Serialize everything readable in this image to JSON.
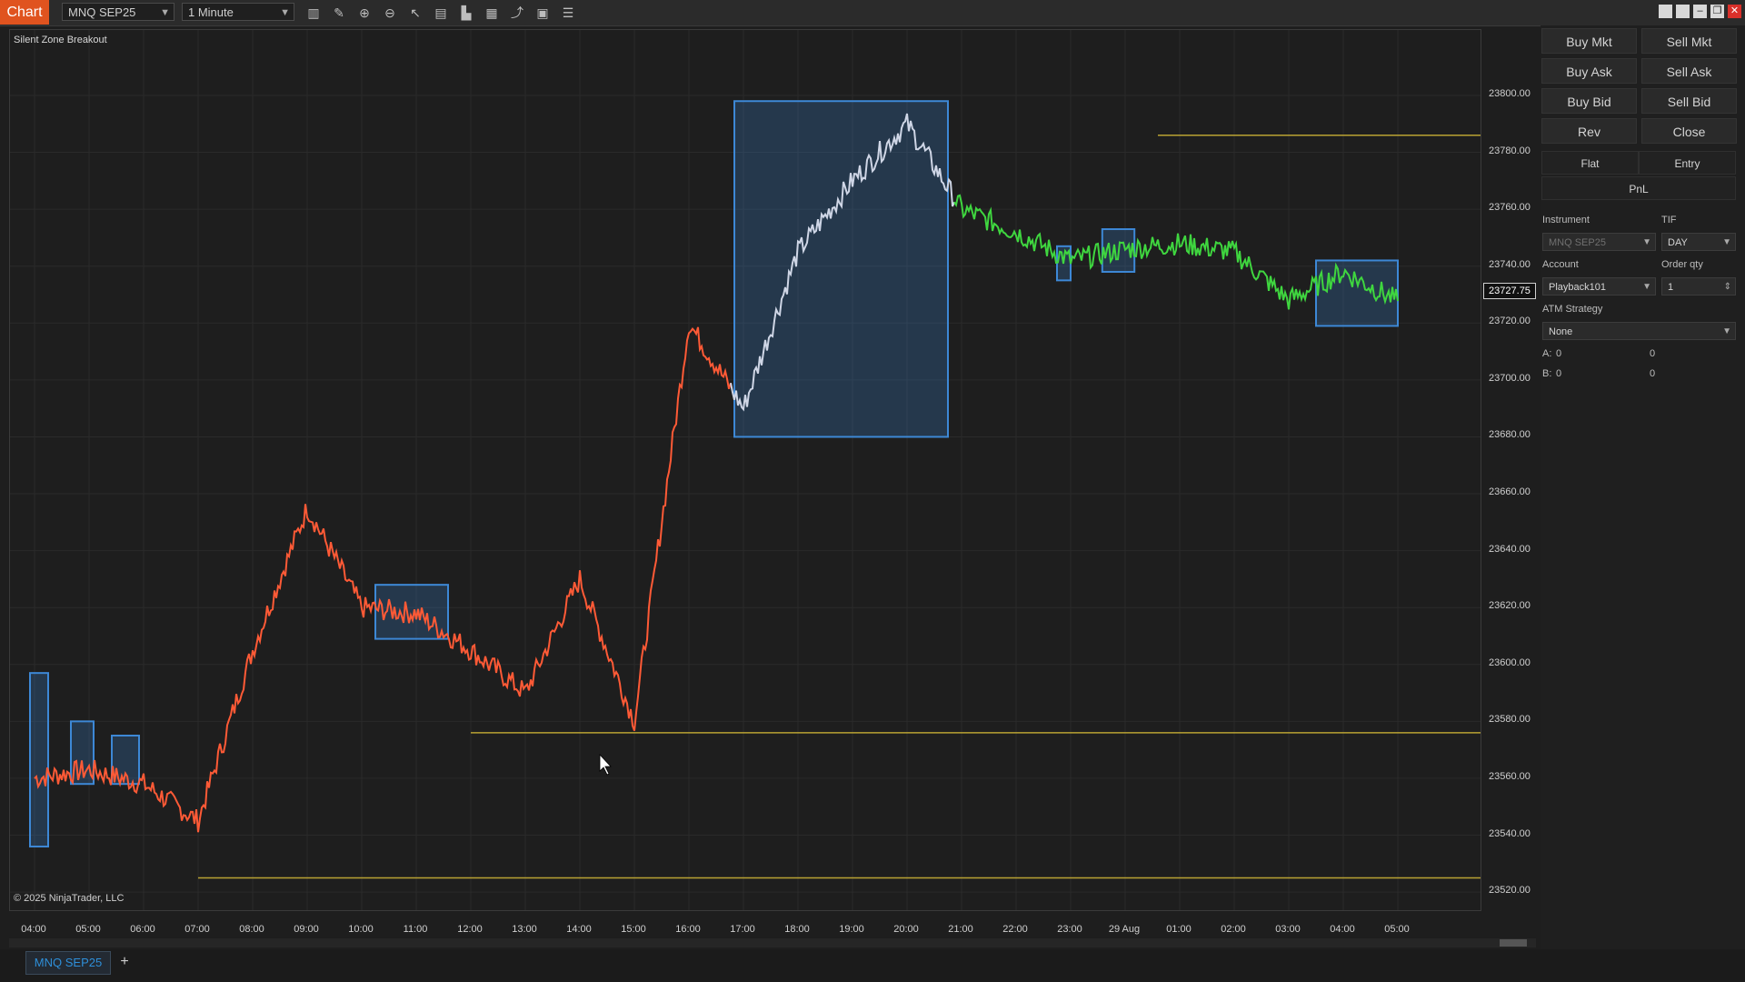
{
  "toolbar": {
    "chart_tab": "Chart",
    "instrument": "MNQ SEP25",
    "interval": "1 Minute",
    "icons": [
      "bar-type-icon",
      "draw-tool-icon",
      "zoom-in-icon",
      "zoom-out-icon",
      "pointer-icon",
      "data-box-icon",
      "properties-icon",
      "indicators-icon",
      "strategies-icon",
      "templates-icon",
      "list-icon"
    ],
    "window_buttons": [
      "tile-icon",
      "workspace-icon",
      "minimize-icon",
      "restore-icon",
      "close-icon"
    ]
  },
  "chart": {
    "title": "Silent Zone Breakout",
    "copyright": "© 2025 NinjaTrader, LLC",
    "current_price": "23727.75",
    "y_labels": [
      "23800.00",
      "23780.00",
      "23760.00",
      "23740.00",
      "23720.00",
      "23700.00",
      "23680.00",
      "23660.00",
      "23640.00",
      "23620.00",
      "23600.00",
      "23580.00",
      "23560.00",
      "23540.00",
      "23520.00"
    ],
    "x_labels": [
      "04:00",
      "05:00",
      "06:00",
      "07:00",
      "08:00",
      "09:00",
      "10:00",
      "11:00",
      "12:00",
      "13:00",
      "14:00",
      "15:00",
      "16:00",
      "17:00",
      "18:00",
      "19:00",
      "20:00",
      "21:00",
      "22:00",
      "23:00",
      "29 Aug",
      "01:00",
      "02:00",
      "03:00",
      "04:00",
      "05:00"
    ],
    "colors": {
      "down": "#ff5a36",
      "up": "#3fd63f",
      "zone": "#3d88d6",
      "level": "#b9a233",
      "neutral": "#cfd6e6"
    }
  },
  "chart_data": {
    "type": "line",
    "x": [
      "04:00",
      "05:00",
      "06:00",
      "07:00",
      "08:00",
      "09:00",
      "10:00",
      "11:00",
      "12:00",
      "13:00",
      "14:00",
      "15:00",
      "16:00",
      "17:00",
      "18:00",
      "19:00",
      "20:00",
      "21:00",
      "22:00",
      "23:00",
      "29 Aug",
      "01:00",
      "02:00",
      "03:00",
      "04:00",
      "05:00"
    ],
    "series": [
      {
        "values": [
          23560,
          23563,
          23558,
          23545,
          23605,
          23655,
          23620,
          23618,
          23605,
          23590,
          23630,
          23580,
          23720,
          23690,
          23745,
          23770,
          23790,
          23760,
          23752,
          23742,
          23746,
          23748,
          23745,
          23728,
          23738,
          23727.75
        ]
      }
    ],
    "levels": [
      23786,
      23576,
      23525
    ],
    "zones": [
      {
        "x": [
          "03:55",
          "04:15"
        ],
        "y": [
          23536,
          23597
        ]
      },
      {
        "x": [
          "04:40",
          "05:05"
        ],
        "y": [
          23558,
          23580
        ]
      },
      {
        "x": [
          "05:25",
          "05:55"
        ],
        "y": [
          23558,
          23575
        ]
      },
      {
        "x": [
          "10:15",
          "11:35"
        ],
        "y": [
          23609,
          23628
        ]
      },
      {
        "x": [
          "16:50",
          "20:45"
        ],
        "y": [
          23680,
          23798
        ]
      },
      {
        "x": [
          "22:45",
          "23:00"
        ],
        "y": [
          23735,
          23747
        ]
      },
      {
        "x": [
          "23:35",
          "00:10"
        ],
        "y": [
          23738,
          23753
        ]
      },
      {
        "x": [
          "03:30",
          "05:00"
        ],
        "y": [
          23719,
          23742
        ]
      }
    ],
    "ylim": [
      23513,
      23823
    ],
    "grid": true,
    "legend": "none"
  },
  "order_panel": {
    "buy_mkt": "Buy Mkt",
    "sell_mkt": "Sell Mkt",
    "buy_ask": "Buy Ask",
    "sell_ask": "Sell Ask",
    "buy_bid": "Buy Bid",
    "sell_bid": "Sell Bid",
    "rev": "Rev",
    "close": "Close",
    "flat": "Flat",
    "entry": "Entry",
    "pnl": "PnL",
    "instrument_label": "Instrument",
    "tif_label": "TIF",
    "instrument_value": "MNQ SEP25",
    "tif_value": "DAY",
    "account_label": "Account",
    "order_qty_label": "Order qty",
    "account_value": "Playback101",
    "order_qty_value": "1",
    "atm_label": "ATM Strategy",
    "atm_value": "None",
    "a_label": "A:",
    "a_value": "0",
    "a_value2": "0",
    "b_label": "B:",
    "b_value": "0",
    "b_value2": "0"
  },
  "bottom": {
    "tab_label": "MNQ SEP25",
    "add_tab": "+"
  }
}
